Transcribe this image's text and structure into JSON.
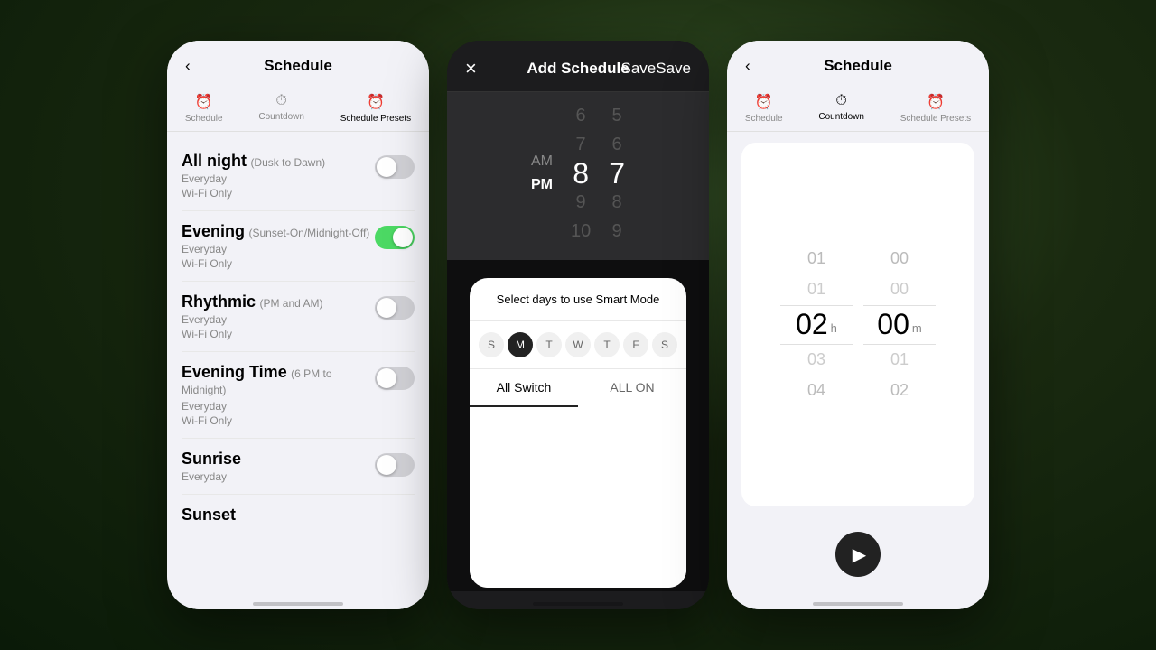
{
  "background": "#2a3a1a",
  "panels": {
    "left": {
      "header": {
        "back_icon": "‹",
        "title": "Schedule",
        "save_label": ""
      },
      "tabs": [
        {
          "icon": "⏰",
          "label": "Schedule",
          "active": false
        },
        {
          "icon": "⏱",
          "label": "Countdown",
          "active": false
        },
        {
          "icon": "⏰",
          "label": "Schedule Presets",
          "active": true
        }
      ],
      "items": [
        {
          "name": "All night",
          "subtitle": "(Dusk to Dawn)",
          "meta1": "Everyday",
          "meta2": "Wi-Fi Only",
          "toggle": "off"
        },
        {
          "name": "Evening",
          "subtitle": "(Sunset-On/Midnight-Off)",
          "meta1": "Everyday",
          "meta2": "Wi-Fi Only",
          "toggle": "on"
        },
        {
          "name": "Rhythmic",
          "subtitle": "(PM and AM)",
          "meta1": "Everyday",
          "meta2": "Wi-Fi Only",
          "toggle": "off"
        },
        {
          "name": "Evening Time",
          "subtitle": "(6 PM to Midnight)",
          "meta1": "Everyday",
          "meta2": "Wi-Fi Only",
          "toggle": "off"
        },
        {
          "name": "Sunrise",
          "subtitle": "",
          "meta1": "Everyday",
          "meta2": "",
          "toggle": "off"
        },
        {
          "name": "Sunset",
          "subtitle": "",
          "meta1": "",
          "meta2": "",
          "toggle": "off"
        }
      ]
    },
    "middle": {
      "header": {
        "close_icon": "×",
        "title": "Add Schedule",
        "save_label": "Save"
      },
      "time_picker": {
        "ampm": [
          "AM",
          "PM"
        ],
        "active_ampm": "PM",
        "hours": [
          "6",
          "7",
          "8",
          "9",
          "10"
        ],
        "active_hour": "8",
        "minutes": [
          "5",
          "6",
          "7",
          "8",
          "9"
        ],
        "active_minute": "7"
      },
      "modal": {
        "header": "Select days to use Smart Mode",
        "days": [
          {
            "label": "S",
            "active": false
          },
          {
            "label": "M",
            "active": true
          },
          {
            "label": "T",
            "active": false
          },
          {
            "label": "W",
            "active": false
          },
          {
            "label": "T",
            "active": false
          },
          {
            "label": "F",
            "active": false
          },
          {
            "label": "S",
            "active": false
          }
        ],
        "tabs": [
          {
            "label": "All Switch",
            "active": true
          },
          {
            "label": "ALL ON",
            "active": false
          }
        ]
      }
    },
    "right": {
      "header": {
        "back_icon": "‹",
        "title": "Schedule",
        "save_label": ""
      },
      "tabs": [
        {
          "icon": "⏰",
          "label": "Schedule",
          "active": false
        },
        {
          "icon": "⏱",
          "label": "Countdown",
          "active": true
        },
        {
          "icon": "⏰",
          "label": "Schedule Presets",
          "active": false
        }
      ],
      "countdown": {
        "hours_above": "01",
        "hours_active": "02",
        "hours_below": "03",
        "hours_below2": "04",
        "hours_unit": "h",
        "minutes_above": "00",
        "minutes_active": "00",
        "minutes_below": "01",
        "minutes_below2": "02",
        "minutes_unit": "m"
      },
      "play_button": "▶"
    }
  }
}
